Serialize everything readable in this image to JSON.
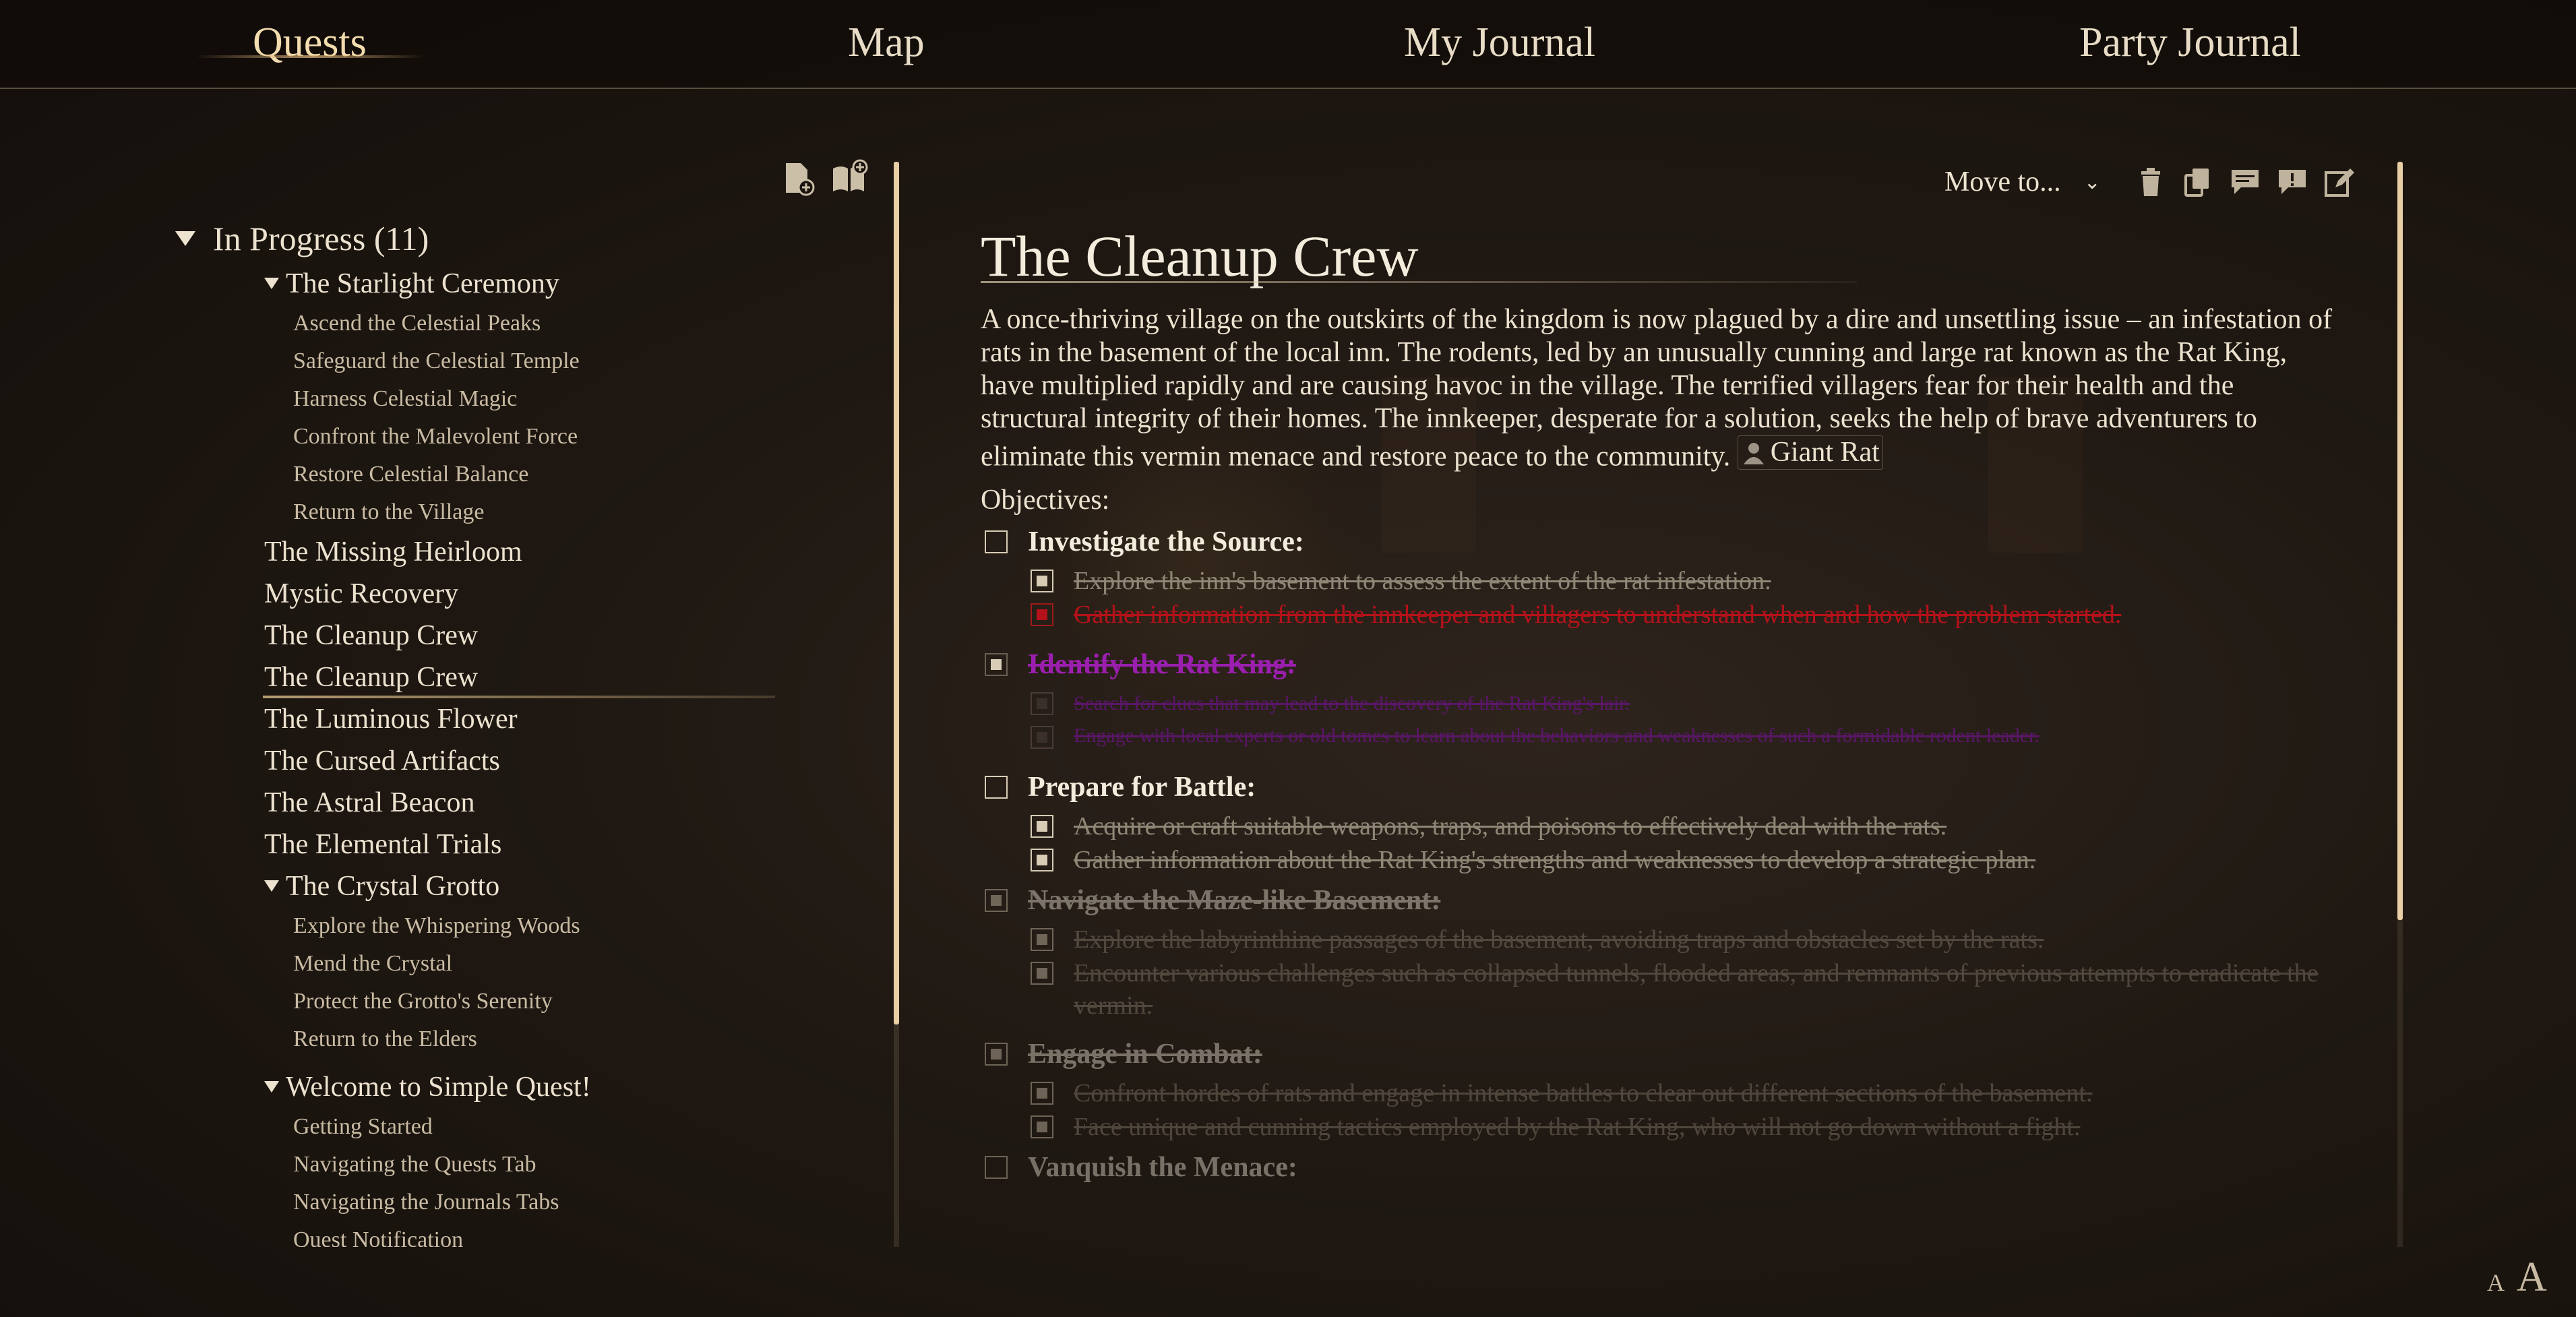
{
  "nav": {
    "tabs": [
      "Quests",
      "Map",
      "My Journal",
      "Party Journal"
    ],
    "active": "Quests"
  },
  "sidebar": {
    "group_header": "In Progress (11)",
    "quests": [
      {
        "title": "The Starlight Ceremony",
        "expanded": true,
        "subquests": [
          "Ascend the Celestial Peaks",
          "Safeguard the Celestial Temple",
          "Harness Celestial Magic",
          "Confront the Malevolent Force",
          "Restore Celestial Balance",
          "Return to the Village"
        ]
      },
      {
        "title": "The Missing Heirloom"
      },
      {
        "title": "Mystic Recovery"
      },
      {
        "title": "The Cleanup Crew"
      },
      {
        "title": "The Cleanup Crew",
        "selected": true
      },
      {
        "title": "The Luminous Flower"
      },
      {
        "title": "The Cursed Artifacts"
      },
      {
        "title": "The Astral Beacon"
      },
      {
        "title": "The Elemental Trials"
      },
      {
        "title": "The Crystal Grotto",
        "expanded": true,
        "subquests": [
          "Explore the Whispering Woods",
          "Mend the Crystal",
          "Protect the Grotto's Serenity",
          "Return to the Elders"
        ]
      },
      {
        "title": "Welcome to Simple Quest!",
        "expanded": true,
        "subquests": [
          "Getting Started",
          "Navigating the Quests Tab",
          "Navigating the Journals Tabs",
          "Quest Notification"
        ]
      }
    ],
    "icons": [
      "new-quest-icon",
      "new-journal-icon"
    ]
  },
  "main": {
    "toolbar": {
      "move_to": "Move to...",
      "icons": [
        "trash-icon",
        "copy-icon",
        "comment-icon",
        "alert-icon",
        "edit-icon"
      ]
    },
    "title": "The Cleanup Crew",
    "description": "A once-thriving village on the outskirts of the kingdom is now plagued by a dire and unsettling issue – an infestation of rats in the basement of the local inn. The rodents, led by an unusually cunning and large rat known as the Rat King, have multiplied rapidly and are causing havoc in the village. The terrified villagers fear for their health and the structural integrity of their homes. The innkeeper, desperate for a solution, seeks the help of brave adventurers to eliminate this vermin menace and restore peace to the community.",
    "linked_actor": "Giant Rat",
    "objectives_label": "Objectives:",
    "objectives": [
      {
        "text": "Investigate the Source:",
        "state": "open",
        "subs": [
          {
            "text": "Explore the inn's basement to assess the extent of the rat infestation.",
            "state": "done"
          },
          {
            "text": "Gather information from the innkeeper and villagers to understand when and how the problem started.",
            "state": "failed"
          }
        ]
      },
      {
        "text": "Identify the Rat King:",
        "state": "done-purple",
        "subs": [
          {
            "text": "Search for clues that may lead to the discovery of the Rat King's lair.",
            "state": "done-purple"
          },
          {
            "text": "Engage with local experts or old tomes to learn about the behaviors and weaknesses of such a formidable rodent leader.",
            "state": "done-purple"
          }
        ]
      },
      {
        "text": "Prepare for Battle:",
        "state": "open",
        "subs": [
          {
            "text": "Acquire or craft suitable weapons, traps, and poisons to effectively deal with the rats.",
            "state": "done"
          },
          {
            "text": "Gather information about the Rat King's strengths and weaknesses to develop a strategic plan.",
            "state": "done"
          }
        ]
      },
      {
        "text": "Navigate the Maze-like Basement:",
        "state": "done-faded",
        "subs": [
          {
            "text": "Explore the labyrinthine passages of the basement, avoiding traps and obstacles set by the rats.",
            "state": "done-faded"
          },
          {
            "text": "Encounter various challenges such as collapsed tunnels, flooded areas, and remnants of previous attempts to eradicate the vermin.",
            "state": "done-faded"
          }
        ]
      },
      {
        "text": "Engage in Combat:",
        "state": "done-faded",
        "subs": [
          {
            "text": "Confront hordes of rats and engage in intense battles to clear out different sections of the basement.",
            "state": "done-faded"
          },
          {
            "text": "Face unique and cunning tactics employed by the Rat King, who will not go down without a fight.",
            "state": "done-faded"
          }
        ]
      },
      {
        "text": "Vanquish the Menace:",
        "state": "open",
        "subs": []
      }
    ]
  },
  "font_controls": {
    "small": "A",
    "large": "A"
  }
}
